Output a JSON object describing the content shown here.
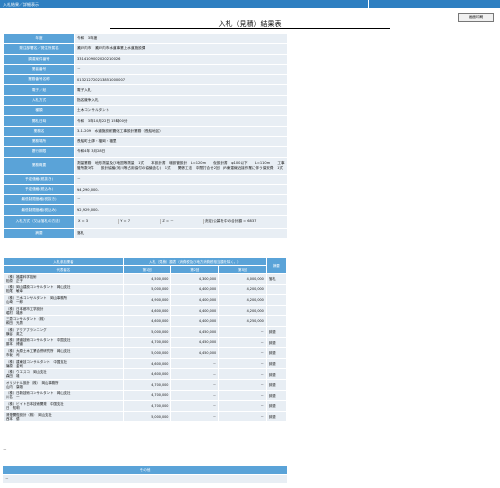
{
  "header": {
    "left_title": "入札結果／詳細表示",
    "right_title": "",
    "back_button": "画面印刷"
  },
  "page_title": "入札（見積）結果表",
  "info_rows": [
    {
      "label": "年度",
      "value": "令和　3年度"
    },
    {
      "label": "発注部署名／発注所属名",
      "value": "瀬戸内市　瀬戸内市水道事業上水道施設課"
    },
    {
      "label": "調達案件番号",
      "value": "3314109002020210026"
    },
    {
      "label": "業者番号",
      "value": "－"
    },
    {
      "label": "業務番号名称",
      "value": "013212720213851000007"
    },
    {
      "label": "電子／紙",
      "value": "電子入札"
    },
    {
      "label": "入札方式",
      "value": "指名競争入札"
    },
    {
      "label": "種類",
      "value": "土木コンサルタント"
    },
    {
      "label": "開札日時",
      "value": "令和　3年10月22日 15時00分"
    },
    {
      "label": "業務名",
      "value": "3-1-209　水道施設耐震化工事設計業務（長船地区）"
    },
    {
      "label": "業務場所",
      "value": "長船町土師・福岡・福里"
    },
    {
      "label": "履行期限",
      "value": "令和4年 3月28日"
    },
    {
      "label": "業務概要",
      "value": "測量業務　地形測量及び地図等測量　1式　　本設計書　増設管設計　L=120m　　仮設計書　φ100以下　　L=110m　　工事管所数3件　　設計協議(河川等占用協付の協議含む)　1式　　関係工法　中間打合せ2回　JR東運線近接作業に伴う保安費　1式"
    },
    {
      "label": "予定価格(税抜き)",
      "value": "－"
    },
    {
      "label": "予定価格(税込み)",
      "value": "¥4,290,000-"
    },
    {
      "label": "最低制限価格(税抜き)",
      "value": "－"
    },
    {
      "label": "最低制限価格(税込み)",
      "value": "¥2,929,000-"
    },
    {
      "label": "入札方式(又は落札の方法)",
      "value": ""
    },
    {
      "label": "摘要",
      "value": "落札"
    }
  ],
  "condition_row": {
    "label": "入札方式（又は落札の方法）",
    "x": "X = 3",
    "y": "Y = 7",
    "z": "Z = －",
    "note": "決定(公募を中の合計額 = 6837"
  },
  "bids_header": {
    "col1": "入札参加業者",
    "col1_sub": "代表者名",
    "col2": "入札（見積）額表（消費税及び地方消費税相当額を除く。）",
    "round1": "第1回",
    "round2": "第2回",
    "round3": "第3回",
    "result": "摘要"
  },
  "bids": [
    {
      "name": "（株）福建科学技術　\n松原　正子",
      "r1": "4,500,000",
      "r2": "4,300,000",
      "r3": "4,000,000",
      "result": "落札"
    },
    {
      "name": "（株）岡山建設コンサルタント　岡山支社\n松尾　敏幸",
      "r1": "5,000,000",
      "r2": "4,400,000",
      "r3": "4,200,000",
      "result": ""
    },
    {
      "name": "（株）三水コンサルタント　岡山事務所\n山崎　一郎",
      "r1": "4,900,000",
      "r2": "4,400,000",
      "r3": "4,200,000",
      "result": ""
    },
    {
      "name": "（株）日本都市工学設計\n堀村　雄彦",
      "r1": "4,600,000",
      "r2": "4,400,000",
      "r3": "4,200,000",
      "result": ""
    },
    {
      "name": "三恵コンサルタント（株）\n和田　光男",
      "r1": "4,600,000",
      "r2": "4,400,000",
      "r3": "4,250,000",
      "result": ""
    },
    {
      "name": "（株）アクアプランニング\n横谷　英之",
      "r1": "5,000,000",
      "r2": "4,450,000",
      "r3": "－",
      "result": "辞退"
    },
    {
      "name": "（株）清道技術コンサルタント　中国支社\n藤本　博道",
      "r1": "4,700,000",
      "r2": "4,450,000",
      "r3": "－",
      "result": "辞退"
    },
    {
      "name": "（株）大原土木工業合併研究所　岡山支社\n市坂　司",
      "r1": "5,000,000",
      "r2": "4,450,000",
      "r3": "－",
      "result": "辞退"
    },
    {
      "name": "（株）建東技コンサルタント　中国支社\n篠原　金司",
      "r1": "4,600,000",
      "r2": "－",
      "r3": "－",
      "result": "辞退"
    },
    {
      "name": "（株）ウエスコ　岡山支社\n森田　雄",
      "r1": "4,600,000",
      "r2": "－",
      "r3": "－",
      "result": "辞退"
    },
    {
      "name": "オリジナル設計（株）　岡山事務所\n山内　康雄",
      "r1": "4,700,000",
      "r2": "－",
      "r3": "－",
      "result": "辞退"
    },
    {
      "name": "（株）日新技術コンサルタント　岡山支社\n川名　一",
      "r1": "4,700,000",
      "r2": "－",
      "r3": "－",
      "result": "辞退"
    },
    {
      "name": "（株）ビイト日本技術開発　中国支社\n日　知明",
      "r1": "4,700,000",
      "r2": "－",
      "r3": "－",
      "result": "辞退"
    },
    {
      "name": "清澄開復設計（株）　岡山支社\n西本　優",
      "r1": "5,000,000",
      "r2": "－",
      "r3": "－",
      "result": "辞退"
    }
  ],
  "after_bids": "－",
  "other": {
    "header": "その他",
    "value": "－"
  }
}
